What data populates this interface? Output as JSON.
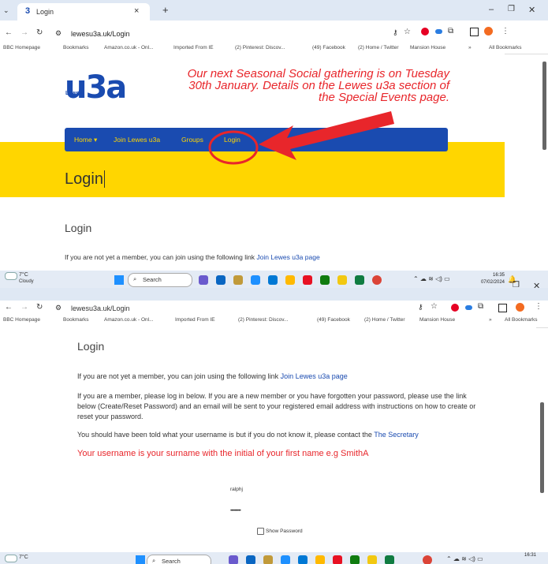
{
  "browser": {
    "tab_title": "Login",
    "tab_close": "×",
    "new_tab": "+",
    "url": "lewesu3a.uk/Login",
    "window_controls": {
      "minimize": "–",
      "restore": "❐",
      "close": "✕"
    },
    "bookmarks": [
      "BBC Homepage",
      "Bookmarks",
      "Amazon.co.uk - Onl...",
      "Imported From IE",
      "(2) Pinterest: Discov...",
      "(49) Facebook",
      "(2) Home / Twitter",
      "Mansion House"
    ],
    "more": "»",
    "all_bookmarks": "All Bookmarks"
  },
  "site": {
    "logo": "u3a",
    "logo_sub": "Lewes",
    "banner": "Our next Seasonal Social gathering is on Tuesday 30th January. Details on the Lewes u3a section of the Special Events page.",
    "nav": [
      "Home ▾",
      "Join Lewes u3a",
      "Groups",
      "Login"
    ],
    "page_heading": "Login",
    "section_heading": "Login",
    "intro": "If you are not yet a member, you can join using the following link",
    "intro_link": "Join Lewes u3a page",
    "member_text": "If you are a member, please log in below. If you are a new member or you have forgotten your password, please use the link below (Create/Reset Password) and an email will be sent to your registered email address with instructions on how to create or reset your password.",
    "username_text": "You should have been told what your username is but if you do not know it, please contact the",
    "username_link": "The Secretary",
    "username_hint": "Your username is your surname with the initial of your first name e.g SmithA",
    "username_value": "ralphj",
    "password_value": "••••••••••",
    "show_password": "Show Password"
  },
  "taskbar": {
    "weather_temp": "7°C",
    "weather_desc": "Cloudy",
    "search": "Search",
    "time1": "16:35",
    "date1": "07/02/2024",
    "time2": "16:31"
  },
  "colors": {
    "brand_blue": "#1a4bb0",
    "brand_yellow": "#ffd600",
    "alert_red": "#e8262b"
  }
}
